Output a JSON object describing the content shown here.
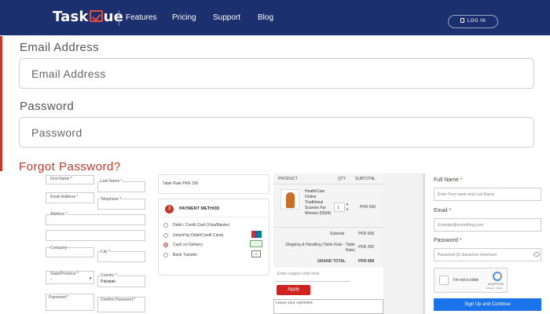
{
  "navbar": {
    "logo_pre": "Task",
    "logo_post": "ue",
    "links": [
      "Features",
      "Pricing",
      "Support",
      "Blog"
    ],
    "login": "LOG IN"
  },
  "login_form": {
    "email_label": "Email Address",
    "email_placeholder": "Email Address",
    "password_label": "Password",
    "password_placeholder": "Password",
    "forgot": "Forgot Password?"
  },
  "panel_billing": {
    "first_name": "First Name *",
    "last_name": "Last Name *",
    "email": "Email Address *",
    "telephone": "Telephone *",
    "address": "Address *",
    "company": "Company",
    "city": "City *",
    "state": "State/Province *",
    "state_value": "-",
    "country": "Country *",
    "country_value": "Pakistan",
    "password": "Password *",
    "confirm_password": "Confirm Password *"
  },
  "panel_payment": {
    "shipping_line": "Table Rate PKR 200",
    "step": "3",
    "title": "PAYMENT METHOD",
    "options": [
      "Debit / Credit Card (Visa/Master)",
      "UnionPay Debit/Credit Cards",
      "Cash on Delivery",
      "Bank Transfer"
    ],
    "selected_index": 2
  },
  "panel_order": {
    "headers": [
      "PRODUCT",
      "QTY",
      "SUBTOTAL"
    ],
    "item_name": "HealthCare Online Traditional Scarves For Women (0934)",
    "item_qty": "1",
    "item_price": "PKR 699",
    "subtotal_label": "Subtotal",
    "subtotal_value": "PKR 699",
    "shipping_label": "Shipping & Handling (Table Rate - Table Rate)",
    "shipping_value": "PKR 200",
    "grand_label": "GRAND TOTAL",
    "grand_value": "PKR 899",
    "coupon_placeholder": "Enter coupon code here",
    "apply": "Apply",
    "comment_placeholder": "Leave your comment"
  },
  "panel_signup": {
    "full_name_label": "Full Name",
    "full_name_placeholder": "Enter First name and Last Name",
    "email_label": "Email",
    "email_placeholder": "Example@something.com",
    "password_label": "Password",
    "password_placeholder": "Password (8 characters minimum)",
    "captcha_text": "I'm not a robot",
    "captcha_brand": "reCAPTCHA",
    "captcha_terms": "Privacy - Terms",
    "signup": "Sign Up and Continue",
    "asterisk": "*"
  }
}
